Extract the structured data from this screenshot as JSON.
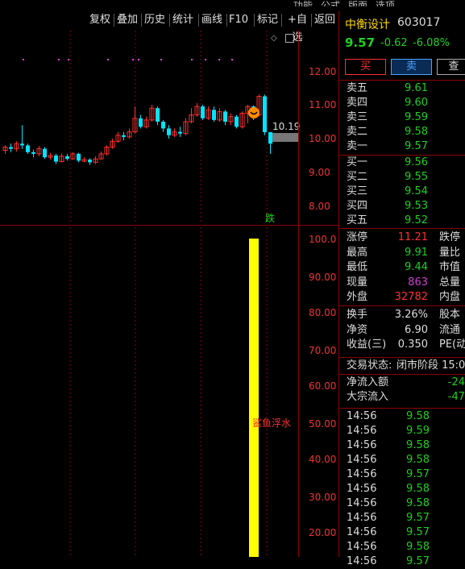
{
  "top_menu": [
    "功能",
    "公式",
    "版面",
    "选项"
  ],
  "toolbar": [
    "复权",
    "叠加",
    "历史",
    "统计",
    "画线",
    "F10",
    "标记",
    "+自选",
    "返回"
  ],
  "stock": {
    "name": "中衡设计",
    "code": "603017",
    "price": "9.57",
    "change": "-0.62",
    "pct": "-6.08%"
  },
  "trade_buttons": {
    "buy": "买",
    "sell": "卖",
    "query": "查"
  },
  "asks": [
    {
      "label": "卖五",
      "price": "9.61"
    },
    {
      "label": "卖四",
      "price": "9.60"
    },
    {
      "label": "卖三",
      "price": "9.59"
    },
    {
      "label": "卖二",
      "price": "9.58"
    },
    {
      "label": "卖一",
      "price": "9.57"
    }
  ],
  "bids": [
    {
      "label": "买一",
      "price": "9.56"
    },
    {
      "label": "买二",
      "price": "9.55"
    },
    {
      "label": "买三",
      "price": "9.54"
    },
    {
      "label": "买四",
      "price": "9.53"
    },
    {
      "label": "买五",
      "price": "9.52"
    }
  ],
  "stats": [
    {
      "l": "涨停",
      "v": "11.21",
      "c": "red",
      "l2": "跌停"
    },
    {
      "l": "最高",
      "v": "9.91",
      "c": "green",
      "l2": "量比"
    },
    {
      "l": "最低",
      "v": "9.44",
      "c": "green",
      "l2": "市值"
    },
    {
      "l": "现量",
      "v": "863",
      "c": "purple",
      "l2": "总量"
    },
    {
      "l": "外盘",
      "v": "32782",
      "c": "red",
      "l2": "内盘"
    }
  ],
  "stats2": [
    {
      "l": "换手",
      "v": "3.26%",
      "l2": "股本"
    },
    {
      "l": "净资",
      "v": "6.90",
      "l2": "流通"
    },
    {
      "l": "收益(三)",
      "v": "0.350",
      "l2": "PE(动"
    }
  ],
  "status": {
    "label": "交易状态:",
    "value": "闭市阶段 15:0"
  },
  "flows": [
    {
      "l": "净流入额",
      "v": "-24"
    },
    {
      "l": "大宗流入",
      "v": "-47"
    }
  ],
  "ticks": [
    {
      "t": "14:56",
      "p": "9.58"
    },
    {
      "t": "14:56",
      "p": "9.59"
    },
    {
      "t": "14:56",
      "p": "9.58"
    },
    {
      "t": "14:56",
      "p": "9.58"
    },
    {
      "t": "14:56",
      "p": "9.57"
    },
    {
      "t": "14:56",
      "p": "9.58"
    },
    {
      "t": "14:56",
      "p": "9.58"
    },
    {
      "t": "14:56",
      "p": "9.57"
    },
    {
      "t": "14:56",
      "p": "9.57"
    },
    {
      "t": "14:56",
      "p": "9.58"
    },
    {
      "t": "14:56",
      "p": "9.57"
    }
  ],
  "kline": {
    "y_ticks": [
      "12.00",
      "11.00",
      "10.00",
      "9.00",
      "8.00"
    ],
    "last_price_label": "10.19",
    "down_marker": "跌"
  },
  "indicator": {
    "y_ticks": [
      "100.0",
      "90.00",
      "80.00",
      "70.00",
      "60.00",
      "50.00",
      "40.00",
      "30.00",
      "20.00"
    ],
    "label": "鲨鱼浮水",
    "bar_value": 100
  },
  "colors": {
    "up": "#ff3030",
    "down": "#00e5ff",
    "bar": "#ffff00",
    "grid": "#8b0000"
  }
}
